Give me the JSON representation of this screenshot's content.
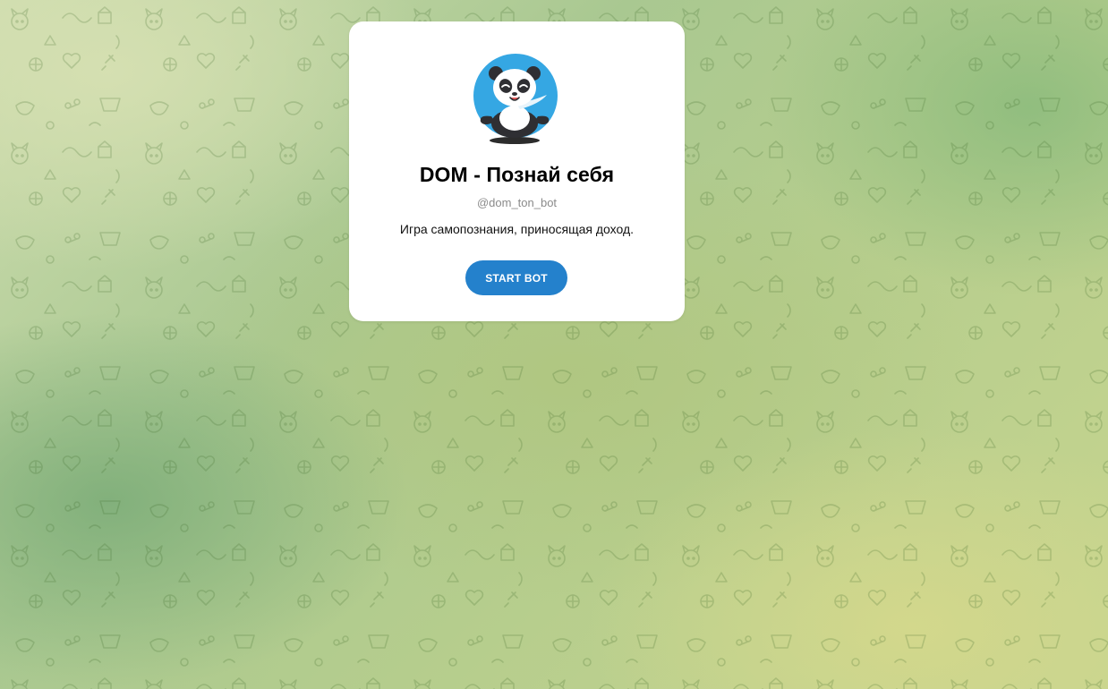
{
  "bot": {
    "name": "DOM - Познай себя",
    "username": "@dom_ton_bot",
    "description": "Игра самопознания, приносящая доход."
  },
  "actions": {
    "start_label": "START BOT"
  },
  "avatar": {
    "icon": "panda-meditating-avatar",
    "background_color": "#35a7e3"
  },
  "colors": {
    "button": "#2481cc",
    "card": "#ffffff"
  }
}
